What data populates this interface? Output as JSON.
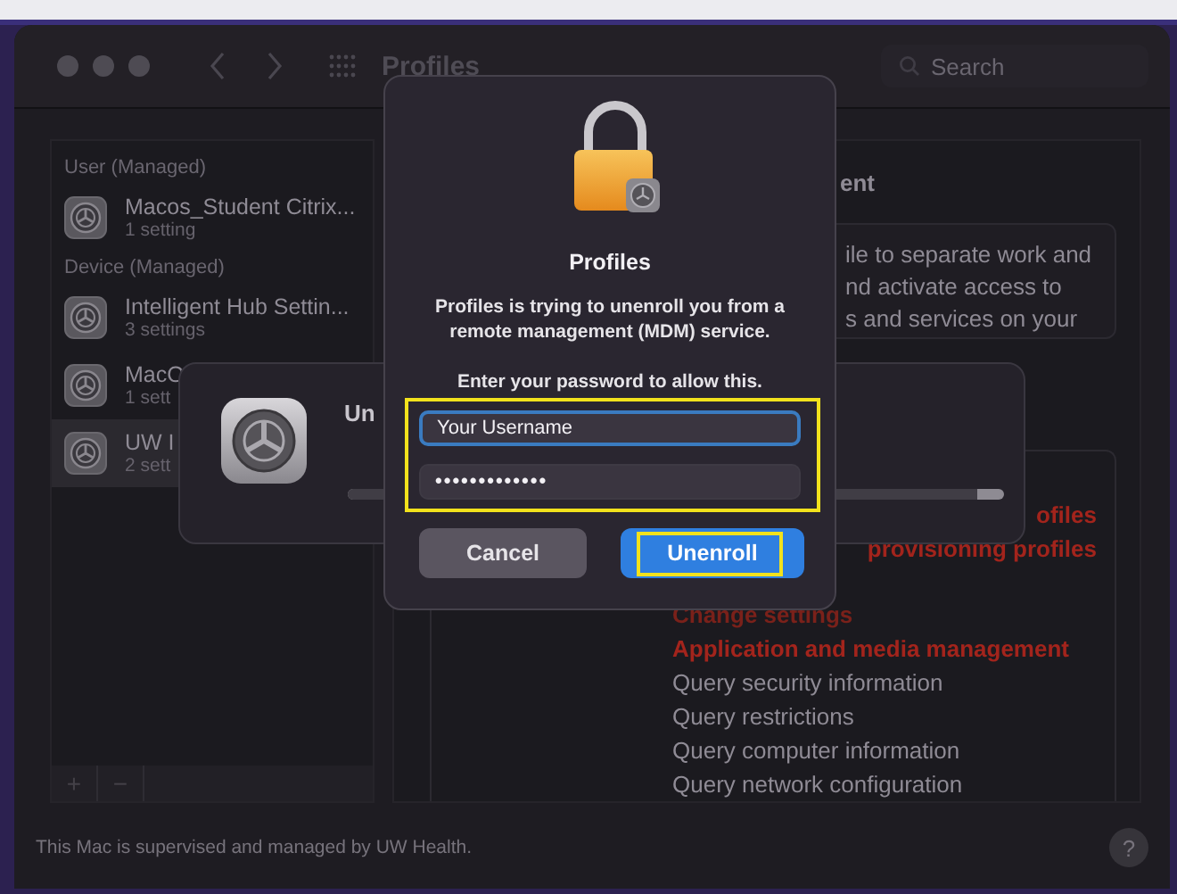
{
  "window": {
    "title": "Profiles"
  },
  "search": {
    "placeholder": "Search"
  },
  "sidebar": {
    "sections": [
      {
        "heading": "User (Managed)",
        "items": [
          {
            "name": "Macos_Student Citrix...",
            "detail": "1 setting",
            "selected": false
          }
        ]
      },
      {
        "heading": "Device (Managed)",
        "items": [
          {
            "name": "Intelligent Hub Settin...",
            "detail": "3 settings",
            "selected": false
          },
          {
            "name": "MacO",
            "detail": "1 sett",
            "selected": false
          },
          {
            "name": "UW I",
            "detail": "2 sett",
            "selected": true
          }
        ]
      }
    ],
    "add_button": "+",
    "remove_button": "−"
  },
  "detail": {
    "heading": "ent",
    "description": [
      "ile to separate work and",
      "nd activate access to",
      "s and services on your"
    ],
    "permissions": [
      {
        "text": "ofiles",
        "kind": "clipped",
        "color": "#a3241c"
      },
      {
        "text": "provisioning profiles",
        "kind": "clipped",
        "color": "#a3241c"
      },
      {
        "text": "Change settings",
        "kind": "full",
        "color": "#7a211a"
      },
      {
        "text": "Application and media management",
        "kind": "full",
        "color": "#a3241c"
      },
      {
        "text": "Query security information",
        "kind": "full",
        "color": "#8f8b95"
      },
      {
        "text": "Query restrictions",
        "kind": "full",
        "color": "#8f8b95"
      },
      {
        "text": "Query computer information",
        "kind": "full",
        "color": "#8f8b95"
      },
      {
        "text": "Query network configuration",
        "kind": "full",
        "color": "#8f8b95"
      }
    ]
  },
  "footer": {
    "text": "This Mac is supervised and managed by UW Health.",
    "help": "?"
  },
  "progress_sheet": {
    "title": "Un",
    "level": 0.96
  },
  "dialog": {
    "title": "Profiles",
    "message": "Profiles is trying to unenroll you from a remote management (MDM) service.",
    "prompt": "Enter your password to allow this.",
    "username": {
      "value": "Your Username",
      "focused": true
    },
    "password": {
      "value": "•••••••••••••"
    },
    "buttons": [
      {
        "label": "Cancel",
        "default": false
      },
      {
        "label": "Unenroll",
        "default": true
      }
    ]
  }
}
